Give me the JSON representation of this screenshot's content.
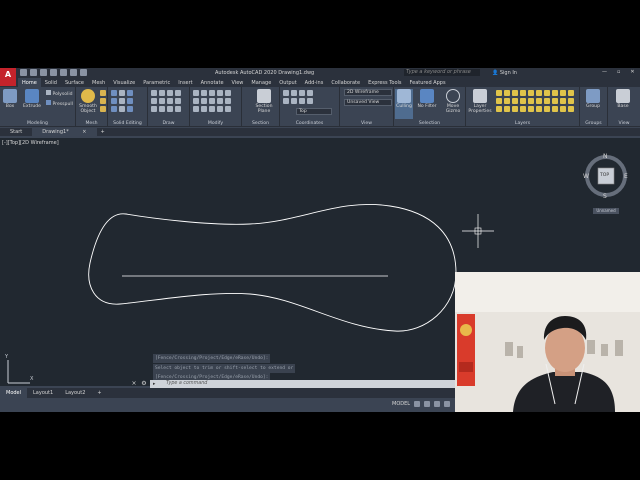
{
  "window": {
    "app_title": "Autodesk AutoCAD 2020   Drawing1.dwg",
    "logo_letter": "A",
    "search_placeholder": "Type a keyword or phrase",
    "signin_label": "Sign In",
    "help_label": "?"
  },
  "ribbon_tabs": [
    "Home",
    "Solid",
    "Surface",
    "Mesh",
    "Visualize",
    "Parametric",
    "Insert",
    "Annotate",
    "View",
    "Manage",
    "Output",
    "Add-ins",
    "Collaborate",
    "Express Tools",
    "Featured Apps"
  ],
  "ribbon": {
    "box_label": "Box",
    "extrude_label": "Extrude",
    "polysolid_label": "Polysolid",
    "presspull_label": "Presspull",
    "smooth_object_label": "Smooth Object",
    "section_plane_label": "Section Plane",
    "culling_label": "Culling",
    "no_filter_label": "No Filter",
    "move_gizmo_label": "Move Gizmo",
    "layer_properties_label": "Layer Properties",
    "group_label": "Group",
    "base_label": "Base",
    "visual_style_value": "2D Wireframe",
    "view_value": "Unsaved View",
    "ucs_value": "Top",
    "panel_titles": {
      "modeling": "Modeling",
      "mesh": "Mesh",
      "solid_editing": "Solid Editing",
      "draw": "Draw",
      "modify": "Modify",
      "section": "Section",
      "coordinates": "Coordinates",
      "view": "View",
      "selection": "Selection",
      "layers": "Layers",
      "groups": "Groups",
      "view2": "View"
    }
  },
  "file_tabs": {
    "start": "Start",
    "drawing": "Drawing1*",
    "close": "×",
    "add": "+"
  },
  "viewport": {
    "label": "[-][Top][2D Wireframe]",
    "viewcube": {
      "face": "TOP",
      "north": "N",
      "south": "S",
      "east": "E",
      "west": "W",
      "wcs": "Unnamed"
    }
  },
  "command": {
    "history": [
      "[Fence/Crossing/Project/Edge/eRase/Undo]:",
      "Select object to trim or shift-select to extend or",
      "[Fence/Crossing/Project/Edge/eRase/Undo]:"
    ],
    "placeholder": "Type a command",
    "close_icon": "×",
    "settings_icon": "⚙"
  },
  "layout_tabs": [
    "Model",
    "Layout1",
    "Layout2",
    "+"
  ],
  "status": {
    "model_label": "MODEL"
  },
  "axis": {
    "y": "Y",
    "x": "X"
  },
  "colors": {
    "canvas_bg": "#212830",
    "ribbon_bg": "#3b4453",
    "dark_chrome": "#2b313c",
    "autocad_red": "#c4232b",
    "geometry_line": "#ffffff"
  }
}
